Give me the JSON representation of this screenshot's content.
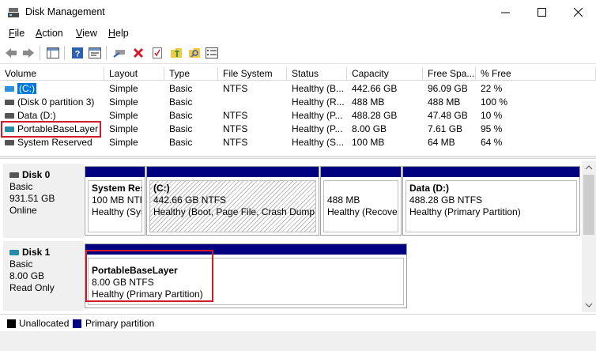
{
  "window": {
    "title": "Disk Management"
  },
  "menu": [
    {
      "label": "File",
      "key": "F",
      "rest": "ile"
    },
    {
      "label": "Action",
      "key": "A",
      "rest": "ction"
    },
    {
      "label": "View",
      "key": "V",
      "rest": "iew"
    },
    {
      "label": "Help",
      "key": "H",
      "rest": "elp"
    }
  ],
  "toolbar": [
    "back-icon",
    "forward-icon",
    "console-tree-icon",
    "help-icon",
    "help-topics-icon",
    "connect-icon",
    "delete-icon",
    "check-icon",
    "refresh-icon",
    "rescan-icon",
    "properties-icon"
  ],
  "volume_table": {
    "headers": [
      "Volume",
      "Layout",
      "Type",
      "File System",
      "Status",
      "Capacity",
      "Free Spa...",
      "% Free"
    ],
    "rows": [
      {
        "volume": "(C:)",
        "layout": "Simple",
        "type": "Basic",
        "fs": "NTFS",
        "status": "Healthy (B...",
        "capacity": "442.66 GB",
        "free": "96.09 GB",
        "pct": "22 %"
      },
      {
        "volume": "(Disk 0 partition 3)",
        "layout": "Simple",
        "type": "Basic",
        "fs": "",
        "status": "Healthy (R...",
        "capacity": "488 MB",
        "free": "488 MB",
        "pct": "100 %"
      },
      {
        "volume": "Data (D:)",
        "layout": "Simple",
        "type": "Basic",
        "fs": "NTFS",
        "status": "Healthy (P...",
        "capacity": "488.28 GB",
        "free": "47.48 GB",
        "pct": "10 %"
      },
      {
        "volume": "PortableBaseLayer",
        "layout": "Simple",
        "type": "Basic",
        "fs": "NTFS",
        "status": "Healthy (P...",
        "capacity": "8.00 GB",
        "free": "7.61 GB",
        "pct": "95 %"
      },
      {
        "volume": "System Reserved",
        "layout": "Simple",
        "type": "Basic",
        "fs": "NTFS",
        "status": "Healthy (S...",
        "capacity": "100 MB",
        "free": "64 MB",
        "pct": "64 %"
      }
    ]
  },
  "disks": [
    {
      "name": "Disk 0",
      "type": "Basic",
      "size": "931.51 GB",
      "state": "Online",
      "partitions": [
        {
          "name": "System Res",
          "size": "100 MB NTF",
          "status": "Healthy (Sys"
        },
        {
          "name": "(C:)",
          "size": "442.66 GB NTFS",
          "status": "Healthy (Boot, Page File, Crash Dump,"
        },
        {
          "name": "",
          "size": "488 MB",
          "status": "Healthy (Recover"
        },
        {
          "name": "Data  (D:)",
          "size": "488.28 GB NTFS",
          "status": "Healthy (Primary Partition)"
        }
      ]
    },
    {
      "name": "Disk 1",
      "type": "Basic",
      "size": "8.00 GB",
      "state": "Read Only",
      "partitions": [
        {
          "name": "PortableBaseLayer",
          "size": "8.00 GB NTFS",
          "status": "Healthy (Primary Partition)"
        }
      ]
    }
  ],
  "legend": [
    {
      "label": "Unallocated",
      "color": "#000000"
    },
    {
      "label": "Primary partition",
      "color": "#000080"
    }
  ],
  "colors": {
    "primary": "#000080",
    "highlight": "#d11b2a",
    "selection": "#0078d7"
  }
}
